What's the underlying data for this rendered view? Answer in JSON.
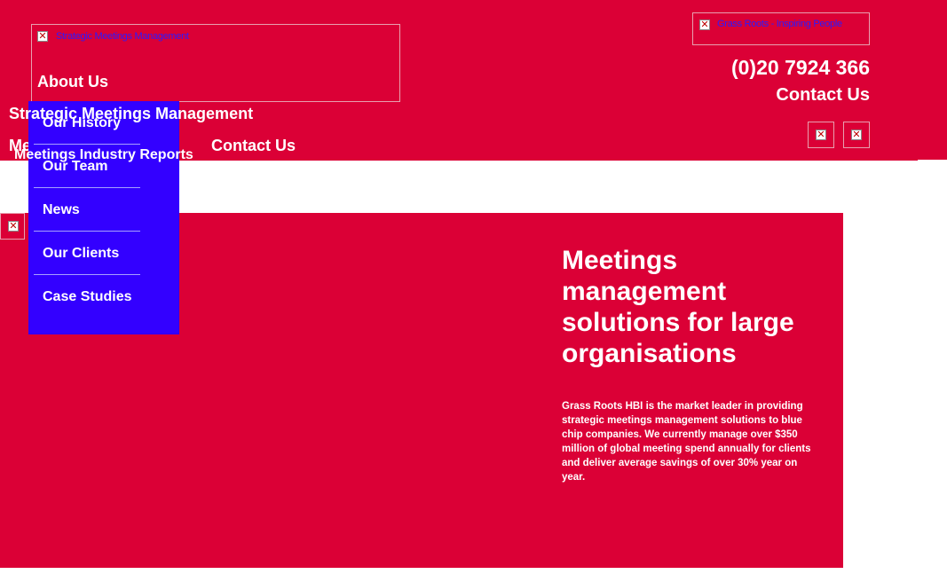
{
  "header": {
    "logo_alt": "Strategic Meetings Management",
    "tagline_alt": "Grass Roots - Inspiring People",
    "phone": "(0)20 7924 366",
    "contact_label": "Contact Us",
    "broken_icon_glyph": "✕"
  },
  "nav": {
    "about": "About Us",
    "smm": "Strategic Meetings Management",
    "meetings_prefix": "Me",
    "reports": "Meetings Industry Reports",
    "contact": "Contact Us"
  },
  "dropdown": {
    "items": [
      "Our History",
      "Our Team",
      "News",
      "Our Clients",
      "Case Studies"
    ]
  },
  "hero": {
    "title": "Meetings management solutions for large organisations",
    "body": "Grass Roots HBI is the market leader in providing strategic meetings management solutions to blue chip companies. We currently manage over $350 million of global meeting spend annually for clients and deliver average savings of over 30% year on year."
  },
  "colors": {
    "brand_red": "#db0036",
    "dropdown_blue": "#3300ff",
    "link_blue": "#2b1aff"
  }
}
